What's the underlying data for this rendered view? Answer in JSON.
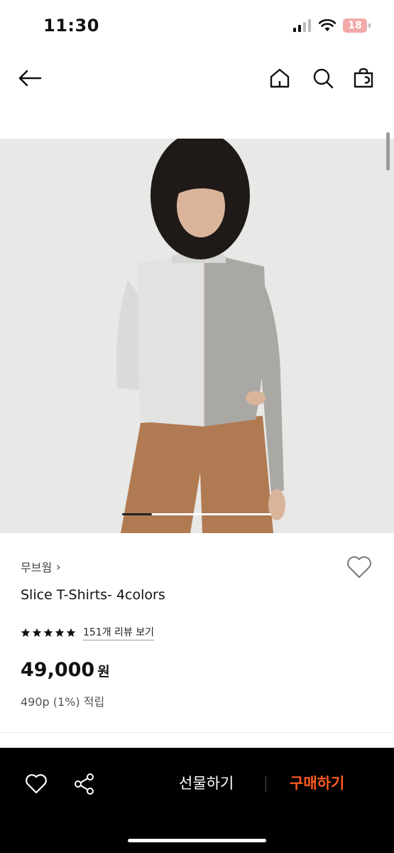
{
  "status": {
    "time": "11:30",
    "battery": "18"
  },
  "header": {
    "back_icon": "back-arrow-icon",
    "home_icon": "home-icon",
    "search_icon": "search-icon",
    "cart_icon": "shopping-bag-icon"
  },
  "product": {
    "brand": "무브웜",
    "brand_chevron": "›",
    "name": "Slice T-Shirts- 4colors",
    "rating": 5,
    "review_link": "151개 리뷰 보기",
    "price": "49,000",
    "price_unit": "원",
    "points": "490p (1%) 적립",
    "carousel_progress": 0.2,
    "image_alt": "model wearing a two-tone grey long-sleeve top and brown trousers"
  },
  "bottom_bar": {
    "wishlist_icon": "heart-outline-icon",
    "share_icon": "share-icon",
    "gift_label": "선물하기",
    "buy_label": "구매하기"
  },
  "colors": {
    "accent": "#ff5a1f",
    "bar": "#000000",
    "image_bg": "#e8e8e6"
  }
}
